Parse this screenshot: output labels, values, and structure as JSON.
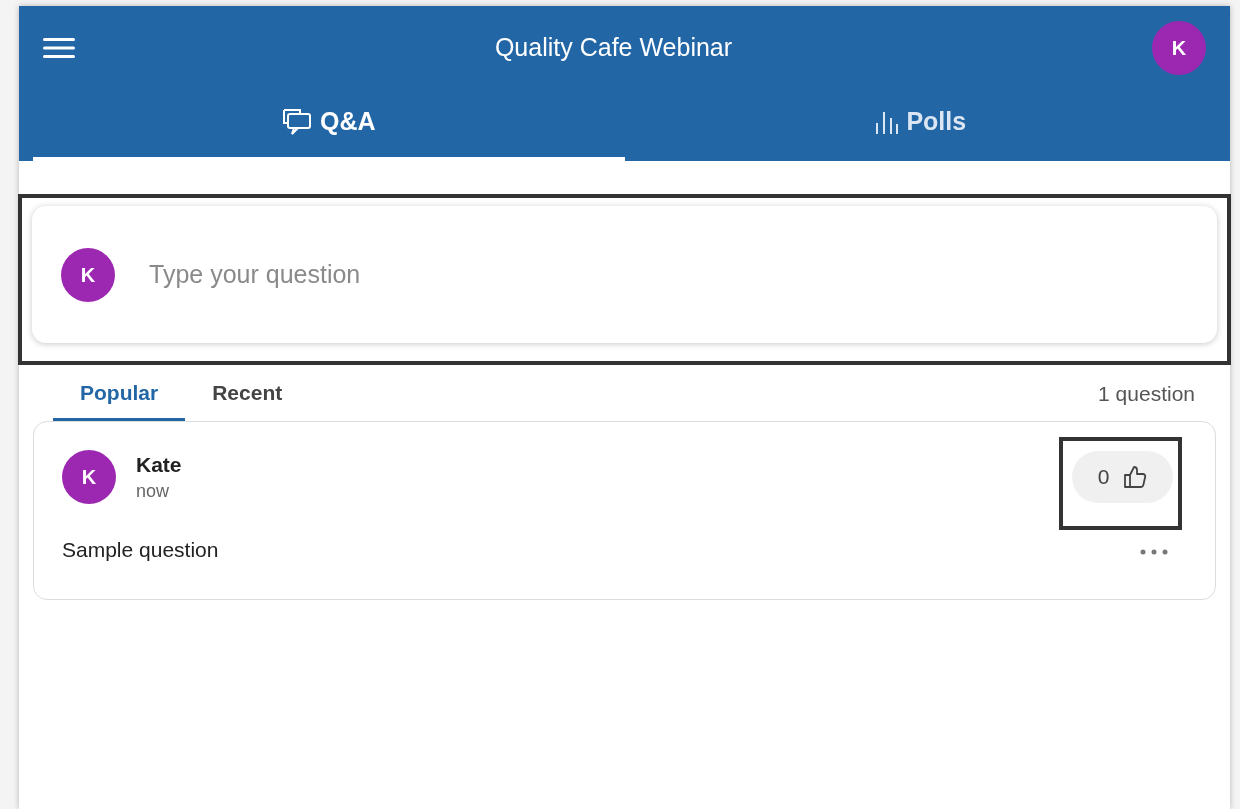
{
  "header": {
    "title": "Quality Cafe Webinar",
    "avatar_initial": "K"
  },
  "tabs": [
    {
      "label": "Q&A",
      "kind": "chat",
      "selected": true
    },
    {
      "label": "Polls",
      "kind": "bars",
      "selected": false
    }
  ],
  "composer": {
    "avatar_initial": "K",
    "placeholder": "Type your question",
    "highlighted": true
  },
  "sort_tabs": [
    {
      "label": "Popular",
      "selected": true
    },
    {
      "label": "Recent",
      "selected": false
    }
  ],
  "question_count": "1 question",
  "questions": [
    {
      "avatar_initial": "K",
      "author": "Kate",
      "time": "now",
      "text": "Sample question",
      "votes": "0",
      "vote_highlighted": true
    }
  ]
}
